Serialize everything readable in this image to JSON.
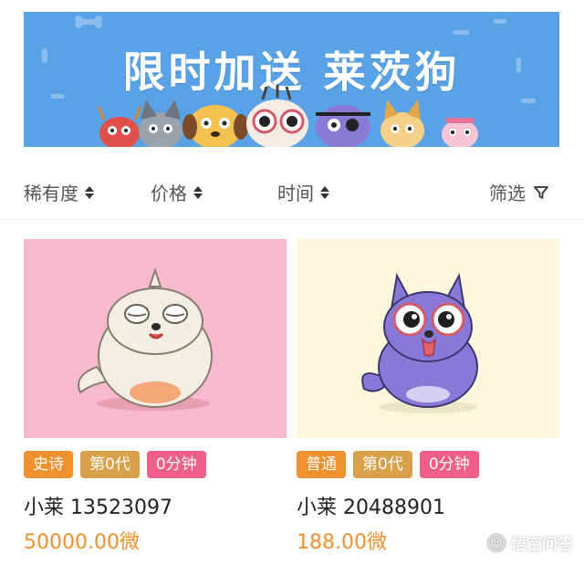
{
  "banner": {
    "title": "限时加送 莱茨狗",
    "background": "#5aa2e6"
  },
  "sort_bar": {
    "items": [
      {
        "label": "稀有度",
        "icon": "sort-arrows-icon"
      },
      {
        "label": "价格",
        "icon": "sort-arrows-icon"
      },
      {
        "label": "时间",
        "icon": "sort-arrows-icon"
      }
    ],
    "filter": {
      "label": "筛选",
      "icon": "filter-funnel-icon"
    }
  },
  "cards": [
    {
      "background": "#f6b9cd",
      "tags": [
        {
          "label": "史诗",
          "color": "#f0912f"
        },
        {
          "label": "第0代",
          "color": "#d8a14a"
        },
        {
          "label": "0分钟",
          "color": "#ef5f8a"
        }
      ],
      "name": "小莱 13523097",
      "price": "50000.00微"
    },
    {
      "background": "#fdf8dd",
      "tags": [
        {
          "label": "普通",
          "color": "#f0912f"
        },
        {
          "label": "第0代",
          "color": "#d8a14a"
        },
        {
          "label": "0分钟",
          "color": "#ef5f8a"
        }
      ],
      "name": "小莱 20488901",
      "price": "188.00微"
    }
  ],
  "watermark": {
    "text": "悟空问答",
    "icon": "wukong-logo-icon"
  }
}
